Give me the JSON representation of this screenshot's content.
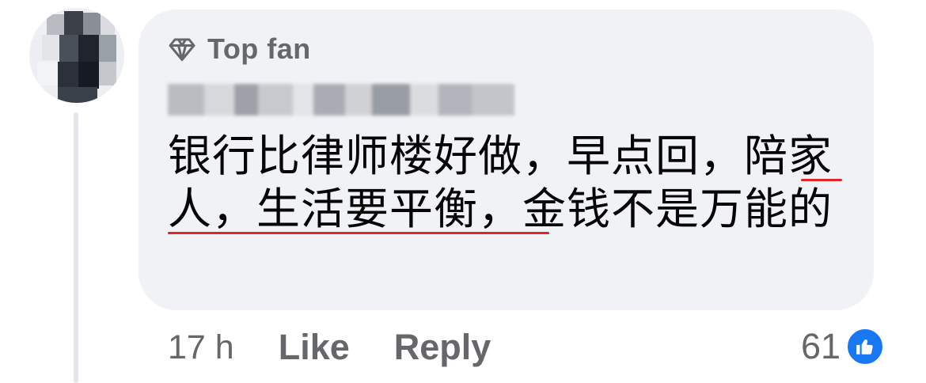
{
  "comment": {
    "badge_label": "Top fan",
    "text": "银行比律师楼好做，早点回，陪家人，生活要平衡，金钱不是万能的",
    "timestamp": "17 h",
    "reaction_count": "61"
  },
  "actions": {
    "like_label": "Like",
    "reply_label": "Reply"
  },
  "icons": {
    "badge": "diamond-icon",
    "reaction": "thumbs-up-icon"
  },
  "colors": {
    "bubble": "#f0f2f5",
    "secondary_text": "#65676b",
    "primary_text": "#050505",
    "like_blue": "#1877f2",
    "underline_red": "#e0242a"
  }
}
